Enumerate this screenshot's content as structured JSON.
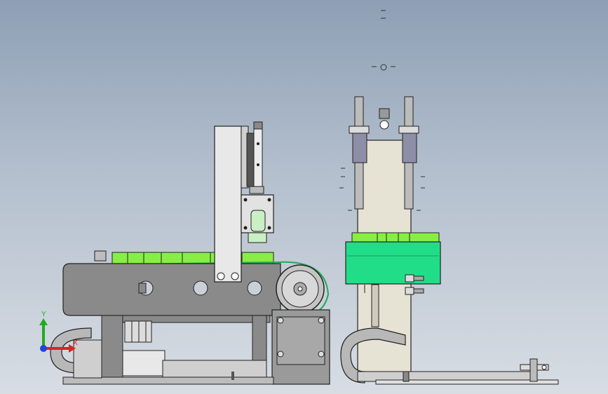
{
  "viewport": {
    "colors": {
      "background_top": "#8e9fb5",
      "background_bottom": "#d8dde4",
      "frame_gray": "#8a8a8a",
      "frame_dark": "#555555",
      "green_part": "#22dd88",
      "lime_part": "#88ee44",
      "sheet_light": "#e6e2d4",
      "edge": "#222222"
    }
  },
  "triad": {
    "x_label": "X",
    "y_label": "Y",
    "x_color": "#dd2222",
    "y_color": "#22aa22",
    "z_color": "#2244dd"
  }
}
